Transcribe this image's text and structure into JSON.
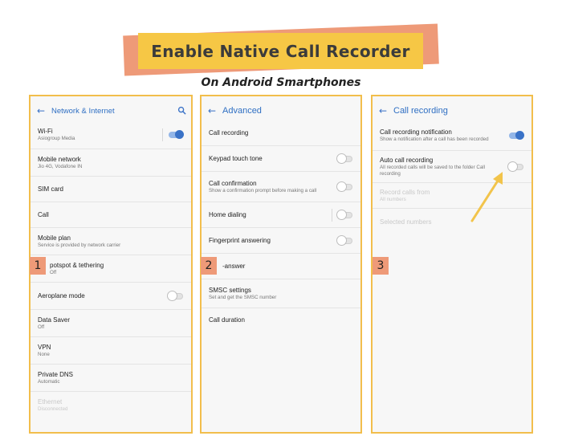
{
  "header": {
    "title": "Enable Native Call Recorder",
    "subtitle": "On Android Smartphones"
  },
  "colors": {
    "accent_blue": "#3A72C7",
    "banner_yellow": "#F6C745",
    "banner_salmon": "#EE9A78",
    "panel_border": "#F2BE4C",
    "arrow": "#F2C44B"
  },
  "panels": {
    "network": {
      "step": "1",
      "title": "Network & Internet",
      "items": [
        {
          "title": "Wi-Fi",
          "sub": "Asiogroup Media",
          "toggle": "on"
        },
        {
          "title": "Mobile network",
          "sub": "Jio 4G, Vodafone IN"
        },
        {
          "title": "SIM card",
          "sub": ""
        },
        {
          "title": "Call",
          "sub": ""
        },
        {
          "title": "Mobile plan",
          "sub": "Service is provided by network carrier"
        },
        {
          "title": "potspot & tethering",
          "sub": "Off"
        },
        {
          "title": "Aeroplane mode",
          "sub": "",
          "toggle": "off"
        },
        {
          "title": "Data Saver",
          "sub": "Off"
        },
        {
          "title": "VPN",
          "sub": "None"
        },
        {
          "title": "Private DNS",
          "sub": "Automatic"
        },
        {
          "title": "Ethernet",
          "sub": "Disconnected"
        }
      ]
    },
    "advanced": {
      "step": "2",
      "title": "Advanced",
      "items": [
        {
          "title": "Call recording",
          "sub": ""
        },
        {
          "title": "Keypad touch tone",
          "sub": "",
          "toggle": "off"
        },
        {
          "title": "Call confirmation",
          "sub": "Show a confirmation prompt before making a call",
          "toggle": "off"
        },
        {
          "title": "Home dialing",
          "sub": "",
          "toggle": "off"
        },
        {
          "title": "Fingerprint answering",
          "sub": "",
          "toggle": "off"
        },
        {
          "title": "-answer",
          "sub": ""
        },
        {
          "title": "SMSC settings",
          "sub": "Set and get the SMSC number"
        },
        {
          "title": "Call duration",
          "sub": ""
        }
      ]
    },
    "recording": {
      "step": "3",
      "title": "Call recording",
      "items": [
        {
          "title": "Call recording notification",
          "sub": "Show a notification after a call has been recorded",
          "toggle": "on"
        },
        {
          "title": "Auto call recording",
          "sub": "All recorded calls will be saved to the folder Call recording",
          "toggle": "off"
        },
        {
          "title": "Record calls from",
          "sub": "All numbers"
        },
        {
          "title": "Selected numbers",
          "sub": ""
        }
      ]
    }
  }
}
